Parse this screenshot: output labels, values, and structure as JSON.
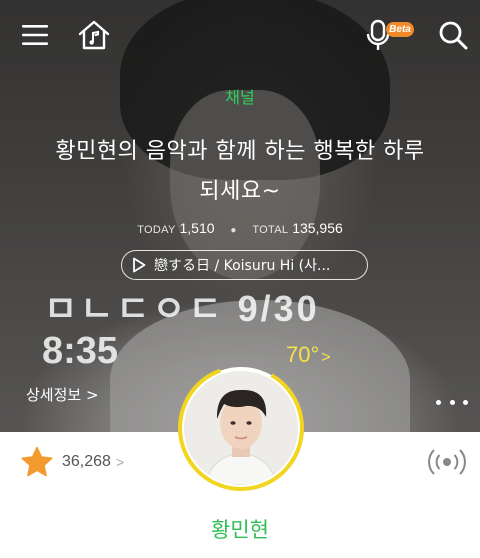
{
  "header": {
    "menu_icon": "hamburger-icon",
    "home_icon": "home-music-icon",
    "mic_icon": "microphone-icon",
    "mic_badge": "Beta",
    "search_icon": "search-icon"
  },
  "channel": {
    "label": "채널",
    "title_line1": "황민현의 음악과 함께 하는 행복한 하루",
    "title_line2": "되세요~",
    "today_label": "TODAY",
    "today_value": "1,510",
    "total_label": "TOTAL",
    "total_value": "135,956"
  },
  "now_playing": {
    "play_icon": "play-icon",
    "text": "戀する日 / Koisuru Hi (사..."
  },
  "overlay": {
    "date": "ㅁㄴㄷㅇㄷ 9/30",
    "time": "8:35",
    "temperature": "70°",
    "temperature_chevron": ">",
    "detail_link": "상세정보 >",
    "more_icon": "more-dots-icon"
  },
  "profile": {
    "likes_icon": "star-icon",
    "likes_count": "36,268",
    "likes_chevron": ">",
    "radio_icon": "radio-broadcast-icon",
    "name": "황민현"
  },
  "colors": {
    "accent_green": "#2fbf55",
    "ring_yellow": "#f2d51e",
    "star_orange": "#f39a2e",
    "temp_yellow": "#f7e24a"
  }
}
